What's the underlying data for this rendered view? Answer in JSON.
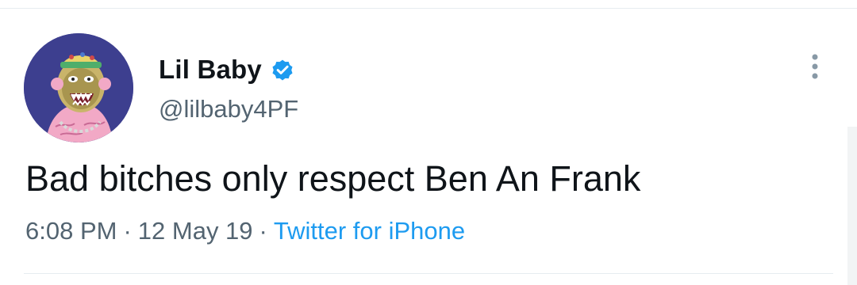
{
  "tweet": {
    "author": {
      "display_name": "Lil Baby",
      "handle": "@lilbaby4PF",
      "verified": true,
      "avatar_icon": "cartoon-ape-avatar-icon"
    },
    "text": "Bad bitches only respect Ben An Frank",
    "meta": {
      "time": "6:08 PM",
      "separator": "·",
      "date": "12 May 19",
      "source": "Twitter for iPhone"
    },
    "menu_icon": "more-vertical-icon"
  },
  "colors": {
    "text_primary": "#0f1419",
    "text_secondary": "#536471",
    "link_blue": "#1d9bf0",
    "verified_blue": "#1d9bf0",
    "avatar_background": "#3d3f8f",
    "divider": "#e6ecf0"
  }
}
